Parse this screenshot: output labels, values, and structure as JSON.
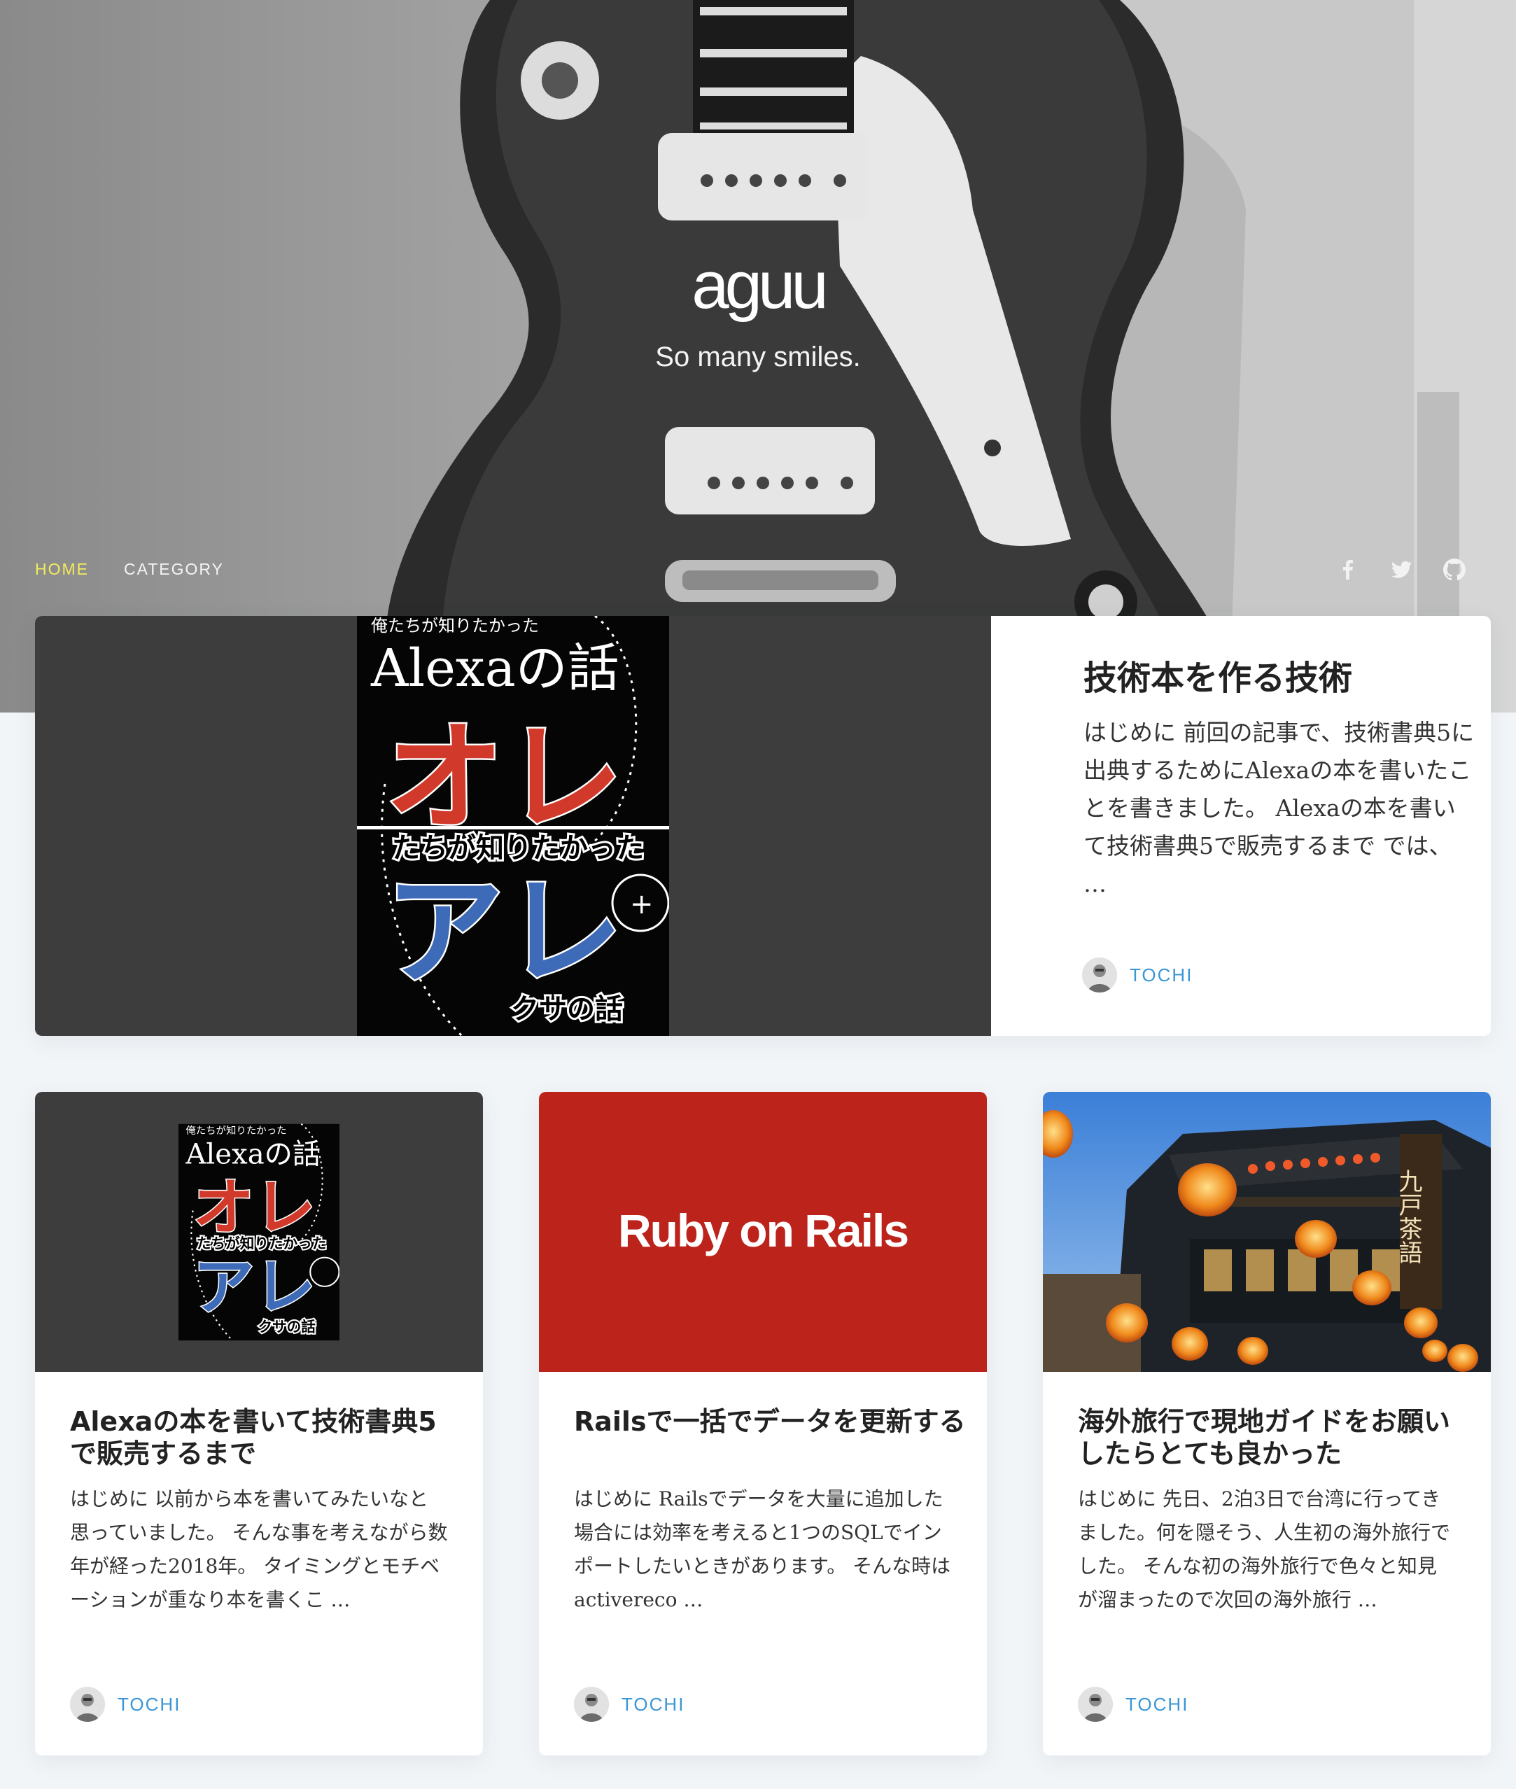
{
  "site": {
    "title": "aguu",
    "tagline": "So many smiles."
  },
  "nav": [
    {
      "label": "HOME",
      "active": true
    },
    {
      "label": "CATEGORY",
      "active": false
    }
  ],
  "social": [
    "facebook-icon",
    "twitter-icon",
    "github-icon"
  ],
  "featured": {
    "title": "技術本を作る技術",
    "excerpt": "はじめに 前回の記事で、技術書典5に出典するためにAlexaの本を書いたことを書きました。 Alexaの本を書いて技術書典5で販売するまで では、 …",
    "author": "TOCHI",
    "cover": {
      "top_label": "俺たちが知りたかった",
      "title": "Alexaの話",
      "red_text": "オレ",
      "band_text": "たちが知りたかった",
      "blue_text": "アレ",
      "bottom_text": "クサの話"
    }
  },
  "cards": [
    {
      "title": "Alexaの本を書いて技術書典5で販売するまで",
      "excerpt": "はじめに 以前から本を書いてみたいなと思っていました。 そんな事を考えながら数年が経った2018年。 タイミングとモチベーションが重なり本を書くこ …",
      "author": "TOCHI"
    },
    {
      "title": "Railsで一括でデータを更新する",
      "excerpt": "はじめに Railsでデータを大量に追加した場合には効率を考えると1つのSQLでインポートしたいときがあります。 そんな時はactivereco …",
      "author": "TOCHI",
      "thumb_text": "Ruby on Rails"
    },
    {
      "title": "海外旅行で現地ガイドをお願いしたらとても良かった",
      "excerpt": "はじめに 先日、2泊3日で台湾に行ってきました。何を隠そう、人生初の海外旅行でした。 そんな初の海外旅行で色々と知見が溜まったので次回の海外旅行 …",
      "author": "TOCHI",
      "sign_text": "九戸茶語"
    }
  ],
  "colors": {
    "accent_nav": "#f3eb5e",
    "author_link": "#3a96d6",
    "rails_red": "#bb231b",
    "thumb_dark": "#3d3d3d",
    "page_bg": "#f2f5f8"
  }
}
